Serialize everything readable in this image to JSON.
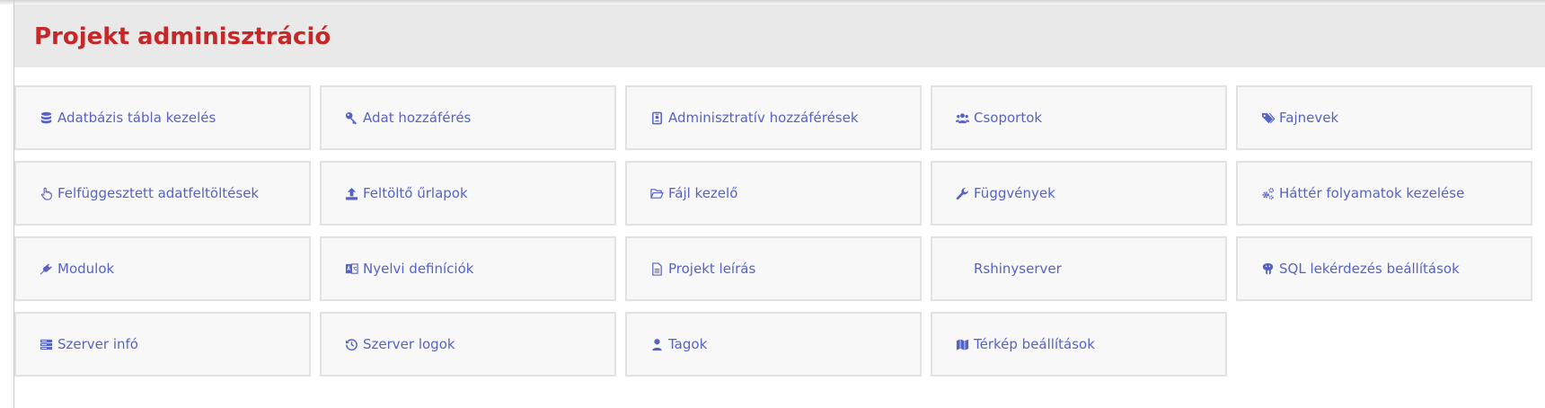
{
  "page": {
    "title": "Projekt adminisztráció"
  },
  "tiles": [
    {
      "label": "Adatbázis tábla kezelés",
      "icon": "database-icon"
    },
    {
      "label": "Adat hozzáférés",
      "icon": "key-icon"
    },
    {
      "label": "Adminisztratív hozzáférések",
      "icon": "id-badge-icon"
    },
    {
      "label": "Csoportok",
      "icon": "users-icon"
    },
    {
      "label": "Fajnevek",
      "icon": "tags-icon"
    },
    {
      "label": "Felfüggesztett adatfeltöltések",
      "icon": "hand-pointer-icon"
    },
    {
      "label": "Feltöltő űrlapok",
      "icon": "upload-icon"
    },
    {
      "label": "Fájl kezelő",
      "icon": "folder-open-icon"
    },
    {
      "label": "Függvények",
      "icon": "wrench-icon"
    },
    {
      "label": "Háttér folyamatok kezelése",
      "icon": "cogs-icon"
    },
    {
      "label": "Modulok",
      "icon": "plug-icon"
    },
    {
      "label": "Nyelvi definíciók",
      "icon": "language-icon"
    },
    {
      "label": "Projekt leírás",
      "icon": "file-text-icon"
    },
    {
      "label": "Rshinyserver",
      "icon": ""
    },
    {
      "label": "SQL lekérdezés beállítások",
      "icon": "database-elephant-icon"
    },
    {
      "label": "Szerver infó",
      "icon": "server-icon"
    },
    {
      "label": "Szerver logok",
      "icon": "history-icon"
    },
    {
      "label": "Tagok",
      "icon": "user-icon"
    },
    {
      "label": "Térkép beállítások",
      "icon": "map-icon"
    }
  ],
  "colors": {
    "title": "#c62828",
    "link": "#5663c4",
    "header_bg": "#e9e9e9",
    "tile_bg": "#f8f8f8"
  }
}
